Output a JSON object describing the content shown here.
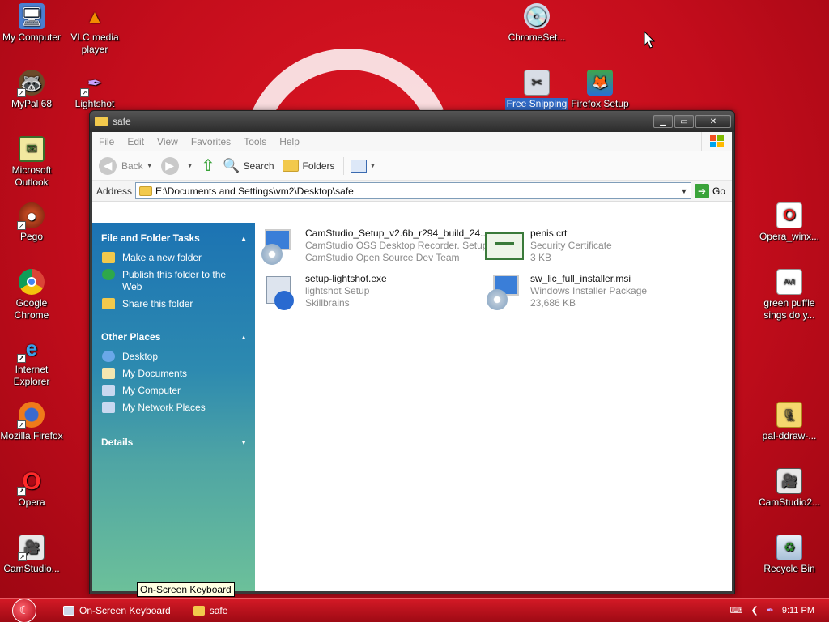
{
  "desktop": {
    "icons": [
      {
        "label": "My Computer",
        "icon": "my-computer-icon"
      },
      {
        "label": "VLC media player",
        "icon": "vlc-icon"
      },
      {
        "label": "MyPal 68",
        "icon": "mypal-icon"
      },
      {
        "label": "Lightshot",
        "icon": "lightshot-icon"
      },
      {
        "label": "Microsoft Outlook",
        "icon": "outlook-icon"
      },
      {
        "label": "Pego",
        "icon": "pego-icon"
      },
      {
        "label": "Google Chrome",
        "icon": "chrome-icon"
      },
      {
        "label": "Internet Explorer",
        "icon": "internet-explorer-icon"
      },
      {
        "label": "Mozilla Firefox",
        "icon": "firefox-icon"
      },
      {
        "label": "Opera",
        "icon": "opera-icon"
      },
      {
        "label": "CamStudio...",
        "icon": "camstudio-icon"
      },
      {
        "label": "ChromeSet...",
        "icon": "chrome-setup-icon"
      },
      {
        "label": "Free Snipping",
        "icon": "free-snipping-icon"
      },
      {
        "label": "Firefox Setup",
        "icon": "firefox-setup-icon"
      },
      {
        "label": "Opera_winx...",
        "icon": "opera-installer-icon"
      },
      {
        "label": "green puffle sings do y...",
        "icon": "avi-file-icon"
      },
      {
        "label": "pal-ddraw-...",
        "icon": "zip-folder-icon"
      },
      {
        "label": "CamStudio2...",
        "icon": "camstudio-setup-icon"
      },
      {
        "label": "Recycle Bin",
        "icon": "recycle-bin-icon"
      }
    ]
  },
  "window": {
    "title": "safe",
    "menu": [
      "File",
      "Edit",
      "View",
      "Favorites",
      "Tools",
      "Help"
    ],
    "toolbar": {
      "back": "Back",
      "search": "Search",
      "folders": "Folders"
    },
    "address": {
      "label": "Address",
      "value": "E:\\Documents and Settings\\vm2\\Desktop\\safe",
      "go": "Go"
    },
    "taskpane": {
      "file_tasks": {
        "title": "File and Folder Tasks",
        "items": [
          "Make a new folder",
          "Publish this folder to the Web",
          "Share this folder"
        ]
      },
      "other_places": {
        "title": "Other Places",
        "items": [
          "Desktop",
          "My Documents",
          "My Computer",
          "My Network Places"
        ]
      },
      "details": {
        "title": "Details"
      }
    },
    "files": [
      {
        "name": "CamStudio_Setup_v2.6b_r294_build_24...",
        "line2": "CamStudio OSS Desktop Recorder. Setup",
        "line3": "CamStudio Open Source Dev Team"
      },
      {
        "name": "penis.crt",
        "line2": "Security Certificate",
        "line3": "3 KB"
      },
      {
        "name": "setup-lightshot.exe",
        "line2": "lightshot Setup",
        "line3": "Skillbrains"
      },
      {
        "name": "sw_lic_full_installer.msi",
        "line2": "Windows Installer Package",
        "line3": "23,686 KB"
      }
    ]
  },
  "tooltip": "On-Screen Keyboard",
  "taskbar": {
    "items": [
      "On-Screen Keyboard",
      "safe"
    ],
    "clock": "9:11 PM"
  }
}
